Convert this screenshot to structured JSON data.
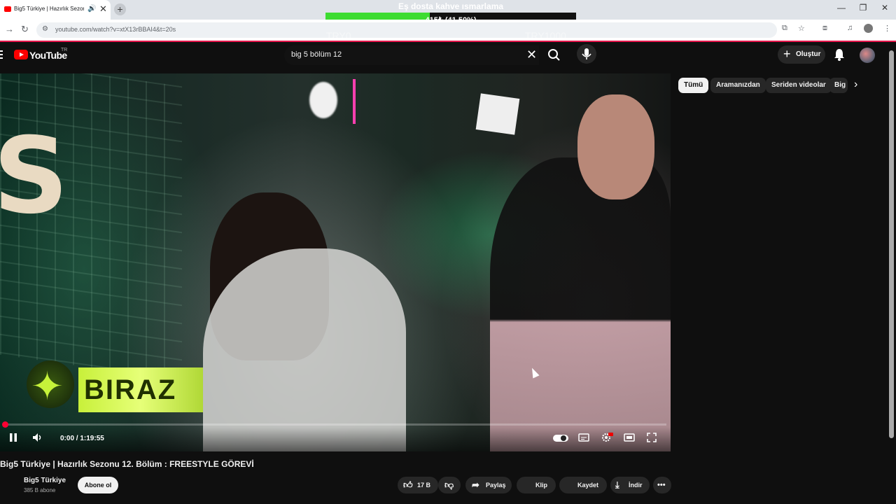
{
  "browser": {
    "tab_title": "Big5 Türkiye | Hazırlık Sezon",
    "url": "youtube.com/watch?v=xtX13rBBAI4&t=20s"
  },
  "donation": {
    "title": "Eş dosta kahve ısmarlama",
    "percent_text": "415₺ (41.50%)",
    "progress": 0.415,
    "min_label": "TRY0",
    "max_label": "TRY1000",
    "fill_color": "#3ddc31"
  },
  "youtube": {
    "logo_text": "YouTube",
    "country_code": "TR",
    "search_query": "big 5 bölüm 12",
    "create_label": "Oluştur"
  },
  "player": {
    "time": "0:00 / 1:19:55",
    "progress": 0.0,
    "video_banner_text": "BIRAZ"
  },
  "chips": [
    "Tümü",
    "Aramanızdan",
    "Seriden videolar",
    "Big"
  ],
  "video": {
    "title": "Big5 Türkiye | Hazırlık Sezonu 12. Bölüm : FREESTYLE GÖREVİ",
    "channel": "Big5 Türkiye",
    "subscribers": "385 B abone",
    "subscribe_label": "Abone ol",
    "likes": "17 B",
    "share_label": "Paylaş",
    "clip_label": "Klip",
    "save_label": "Kaydet",
    "download_label": "İndir"
  },
  "colors": {
    "accent_red": "#ff0000",
    "progress_red": "#ff0033",
    "browser_accent": "#e8174c"
  }
}
